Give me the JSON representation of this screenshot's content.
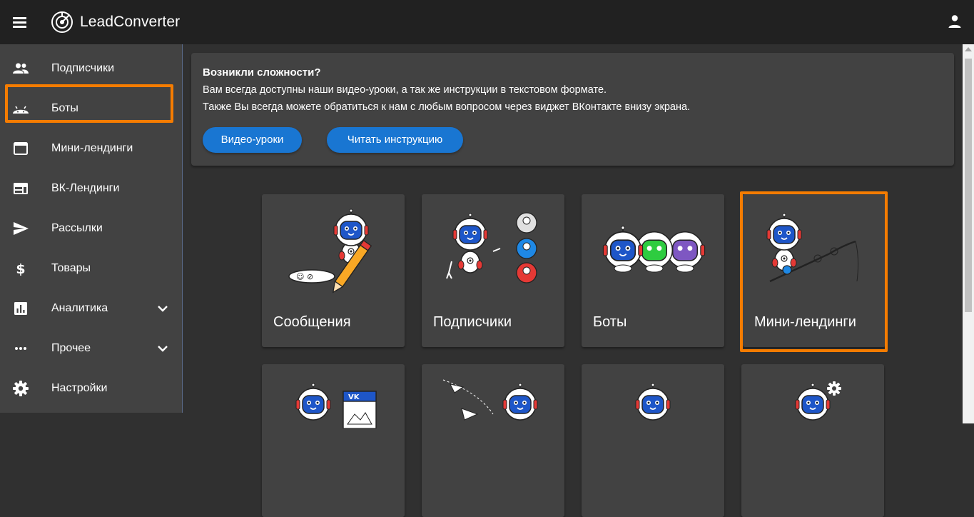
{
  "app": {
    "title": "LeadConverter"
  },
  "colors": {
    "accent": "#f57c00",
    "primary": "#1976d2",
    "topbar": "#212121",
    "panel": "#424242",
    "background": "#303030"
  },
  "sidebar": {
    "items": [
      {
        "label": "Подписчики",
        "icon": "people-icon"
      },
      {
        "label": "Боты",
        "icon": "android-icon"
      },
      {
        "label": "Мини-лендинги",
        "icon": "web-window-icon",
        "highlighted": true
      },
      {
        "label": "ВК-Лендинги",
        "icon": "web-layout-icon"
      },
      {
        "label": "Рассылки",
        "icon": "send-icon"
      },
      {
        "label": "Товары",
        "icon": "dollar-icon"
      },
      {
        "label": "Аналитика",
        "icon": "analytics-icon",
        "expandable": true
      },
      {
        "label": "Прочее",
        "icon": "more-horiz-icon",
        "expandable": true
      },
      {
        "label": "Настройки",
        "icon": "gear-icon"
      }
    ]
  },
  "notice": {
    "title": "Возникли сложности?",
    "line1": "Вам всегда доступны наши видео-уроки, а так же инструкции в текстовом формате.",
    "line2": "Также Вы всегда можете обратиться к нам с любым вопросом через виджет ВКонтакте внизу экрана.",
    "video_button": "Видео-уроки",
    "read_button": "Читать инструкцию"
  },
  "cards": [
    {
      "label": "Сообщения",
      "icon": "robot-pencil-icon"
    },
    {
      "label": "Подписчики",
      "icon": "robot-subscribers-icon"
    },
    {
      "label": "Боты",
      "icon": "robot-group-icon"
    },
    {
      "label": "Мини-лендинги",
      "icon": "robot-fishing-icon",
      "highlighted": true
    },
    {
      "label": "",
      "icon": "robot-vk-icon"
    },
    {
      "label": "",
      "icon": "robot-mailing-icon"
    },
    {
      "label": "",
      "icon": "robot-icon"
    },
    {
      "label": "",
      "icon": "robot-gear-icon"
    }
  ]
}
